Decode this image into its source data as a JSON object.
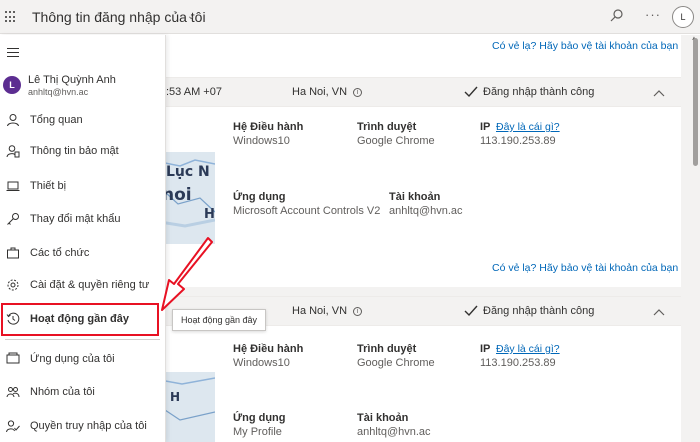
{
  "topbar": {
    "title": "Thông tin đăng nhập của tôi",
    "avatar_initial": "L"
  },
  "user": {
    "initial": "L",
    "name": "Lê Thị Quỳnh Anh",
    "email": "anhltq@hvn.ac"
  },
  "nav": {
    "items": [
      {
        "label": "Tổng quan",
        "icon": "person-icon"
      },
      {
        "label": "Thông tin bảo mật",
        "icon": "security-info-icon"
      },
      {
        "label": "Thiết bị",
        "icon": "laptop-icon"
      },
      {
        "label": "Thay đổi mật khẩu",
        "icon": "key-icon"
      },
      {
        "label": "Các tổ chức",
        "icon": "briefcase-icon"
      },
      {
        "label": "Cài đặt & quyền riêng tư",
        "icon": "gear-icon"
      },
      {
        "label": "Hoạt động gần đây",
        "icon": "history-icon"
      },
      {
        "label": "Ứng dụng của tôi",
        "icon": "apps-icon"
      },
      {
        "label": "Nhóm của tôi",
        "icon": "group-icon"
      },
      {
        "label": "Quyền truy nhập của tôi",
        "icon": "access-icon"
      }
    ],
    "active_index": 6
  },
  "tooltip": "Hoạt động gần đây",
  "top_link": "Có vẻ lạ? Hãy bảo vệ tài khoản của bạn",
  "sessions": [
    {
      "time": ":53 AM +07",
      "location": "Ha Noi, VN",
      "status": "Đăng nhập thành công",
      "os_label": "Hệ Điều hành",
      "os": "Windows10",
      "browser_label": "Trình duyệt",
      "browser": "Google Chrome",
      "ip_label": "IP",
      "ip_link": "Đây là cái gì?",
      "ip": "113.190.253.89",
      "app_label": "Ứng dụng",
      "app": "Microsoft Account Controls V2",
      "account_label": "Tài khoản",
      "account": "anhltq@hvn.ac",
      "link": "Có vẻ lạ? Hãy bảo vệ tài khoản của bạn"
    },
    {
      "time": "",
      "location": "Ha Noi, VN",
      "status": "Đăng nhập thành công",
      "os_label": "Hệ Điều hành",
      "os": "Windows10",
      "browser_label": "Trình duyệt",
      "browser": "Google Chrome",
      "ip_label": "IP",
      "ip_link": "Đây là cái gì?",
      "ip": "113.190.253.89",
      "app_label": "Ứng dụng",
      "app": "My Profile",
      "account_label": "Tài khoản",
      "account": "anhltq@hvn.ac"
    }
  ],
  "map_words": [
    "Lục N",
    "noi",
    "H"
  ],
  "colors": {
    "accent": "#0067b8",
    "avatar": "#5c2d91",
    "highlight": "#e81123"
  }
}
